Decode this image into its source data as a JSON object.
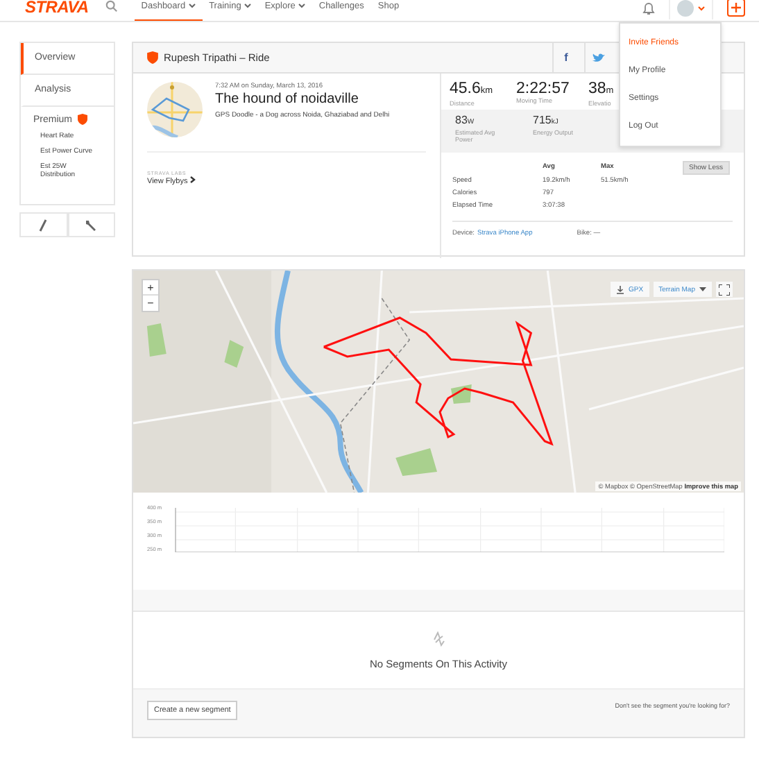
{
  "header": {
    "logo": "STRAVA",
    "nav": [
      {
        "label": "Dashboard",
        "selected": true,
        "has_menu": true
      },
      {
        "label": "Training",
        "selected": false,
        "has_menu": true
      },
      {
        "label": "Explore",
        "selected": false,
        "has_menu": true
      },
      {
        "label": "Challenges",
        "selected": false,
        "has_menu": false
      },
      {
        "label": "Shop",
        "selected": false,
        "has_menu": false
      }
    ]
  },
  "user_menu": {
    "items": [
      {
        "label": "Invite Friends",
        "selected": true
      },
      {
        "label": "My Profile",
        "selected": false
      },
      {
        "label": "Settings",
        "selected": false
      },
      {
        "label": "Log Out",
        "selected": false
      }
    ]
  },
  "sidebar": {
    "items": [
      {
        "label": "Overview",
        "selected": true
      },
      {
        "label": "Analysis",
        "selected": false
      }
    ],
    "premium": {
      "label": "Premium",
      "items": [
        "Heart Rate",
        "Est Power Curve",
        "Est 25W Distribution"
      ]
    }
  },
  "activity": {
    "heading": "Rupesh Tripathi – Ride",
    "share": "f",
    "date": "7:32 AM on Sunday, March 13, 2016",
    "title": "The hound of noidaville",
    "description": "GPS Doodle - a Dog across Noida, Ghaziabad and Delhi",
    "labs": "STRAVA LABS",
    "flybys": "View Flybys",
    "stats": [
      {
        "value": "45.6",
        "unit": "km",
        "label": "Distance"
      },
      {
        "value": "2:22:57",
        "label": "Moving Time"
      },
      {
        "value": "38",
        "unit": "m",
        "label": "Elevatio"
      }
    ],
    "more_stats": [
      {
        "value": "83",
        "unit": "W",
        "label": "Estimated Avg Power"
      },
      {
        "value": "715",
        "unit": "kJ",
        "label": "Energy Output"
      }
    ],
    "table": {
      "columns": [
        "Avg",
        "Max"
      ],
      "rows": [
        {
          "label": "Speed",
          "cells": [
            "19.2km/h",
            "51.5km/h"
          ]
        },
        {
          "label": "Calories",
          "cells": [
            "797"
          ]
        },
        {
          "label": "Elapsed Time",
          "cells": [
            "3:07:38"
          ]
        }
      ]
    },
    "toggle": "Show Less",
    "device_label": "Device:",
    "device": "Strava iPhone App",
    "bike": "Bike: —"
  },
  "map": {
    "zoom_in": "+",
    "zoom_out": "−",
    "gpx": "GPX",
    "map_type": "Terrain Map",
    "attribution": "© Mapbox © OpenStreetMap",
    "improve": "Improve this map"
  },
  "elevation": {
    "ticks": [
      "400 m",
      "350 m",
      "300 m",
      "250 m"
    ]
  },
  "segments": {
    "empty": "No Segments On This Activity",
    "create": "Create a new segment",
    "prompt": "Don't see the segment you're looking for?"
  }
}
